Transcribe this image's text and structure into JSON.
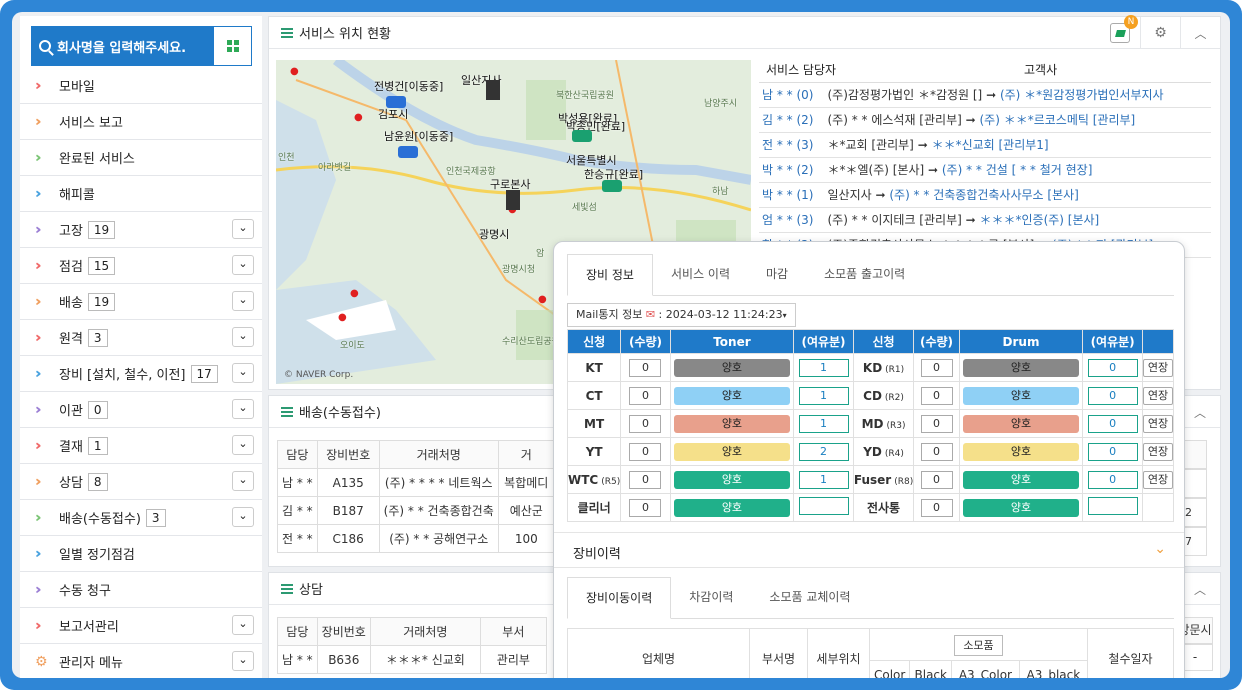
{
  "sidebar": {
    "search_label": "회사명을 입력해주세요.",
    "items": [
      {
        "label": "모바일",
        "color": "#f06a6a"
      },
      {
        "label": "서비스 보고",
        "color": "#f0a060"
      },
      {
        "label": "완료된 서비스",
        "color": "#7cc576"
      },
      {
        "label": "해피콜",
        "color": "#4aa3df"
      },
      {
        "label": "고장",
        "count": "19",
        "color": "#9b7fd4"
      },
      {
        "label": "점검",
        "count": "15",
        "color": "#f06a6a"
      },
      {
        "label": "배송",
        "count": "19",
        "color": "#f0a060"
      },
      {
        "label": "원격",
        "count": "3",
        "color": "#f06a6a"
      },
      {
        "label": "장비 [설치, 철수, 이전]",
        "count": "17",
        "color": "#4aa3df"
      },
      {
        "label": "이관",
        "count": "0",
        "color": "#9b7fd4"
      },
      {
        "label": "결재",
        "count": "1",
        "color": "#f06a6a"
      },
      {
        "label": "상담",
        "count": "8",
        "color": "#f0a060"
      },
      {
        "label": "배송(수동접수)",
        "count": "3",
        "color": "#7cc576"
      },
      {
        "label": "일별 정기점검",
        "color": "#4aa3df"
      },
      {
        "label": "수동 청구",
        "color": "#9b7fd4"
      },
      {
        "label": "보고서관리",
        "color": "#f06a6a"
      },
      {
        "label": "관리자 메뉴",
        "color": "#f0a060"
      }
    ]
  },
  "service": {
    "title": "서비스 위치 현황",
    "badge": "N",
    "col_staff": "서비스 담당자",
    "col_client": "고객사",
    "rows": [
      {
        "staff": "남 * * (0)",
        "from": "(주)감정평가법인 ＊*감정원 []",
        "to": "(주) ＊*원감정평가법인서부지사"
      },
      {
        "staff": "김 * * (2)",
        "from": "(주) * * 에스석재 [관리부]",
        "to": "(주) ＊＊*르코스메틱 [관리부]"
      },
      {
        "staff": "전 * * (3)",
        "from": "＊*교회 [관리부]",
        "to": "＊＊*신교회 [관리부1]"
      },
      {
        "staff": "박 * * (2)",
        "from": "＊*＊엘(주) [본사]",
        "to": "(주) * * 건설 [ * * 철거 현장]"
      },
      {
        "staff": "박 * * (1)",
        "from": "일산지사",
        "to": "(주) * * 건축종합건축사사무소 [본사]"
      },
      {
        "staff": "엄 * * (3)",
        "from": "(주) * * 이지테크 [관리부]",
        "to": "＊＊＊*인증(주) [본사]"
      },
      {
        "staff": "한 * * (2)",
        "from": "(주)종합건축사사무소 ＊＊＊＊루 [본사]",
        "to": "(주) * * 피 [관리부]"
      }
    ],
    "map": {
      "copyright": "© NAVER Corp.",
      "labels": [
        "일산지사",
        "전병건[이동중]",
        "김포시",
        "남윤원[이동중]",
        "박성용[완료]",
        "박종민[완료]",
        "서울특별시",
        "한승규[완료]",
        "구로본사",
        "광명시",
        "남양주시",
        "하남",
        "인천",
        "오이도",
        "북한산국립공원",
        "아라뱃길",
        "인천국제공항",
        "세빛섬",
        "광명시청",
        "수리산도립공원",
        "암"
      ]
    }
  },
  "delivery": {
    "title": "배송(수동접수)",
    "headers": [
      "담당",
      "장비번호",
      "거래처명",
      "거"
    ],
    "rows": [
      [
        "남 * *",
        "A135",
        "(주) * * * * 네트웍스",
        "복합메디"
      ],
      [
        "김 * *",
        "B187",
        "(주) * * 건축종합건축",
        "예산군"
      ],
      [
        "전 * *",
        "C186",
        "(주) * * 공해연구소",
        "100"
      ]
    ],
    "right_times": [
      "42",
      "17"
    ]
  },
  "consult": {
    "title": "상담",
    "headers": [
      "담당",
      "장비번호",
      "거래처명",
      "부서"
    ],
    "rows": [
      [
        "남 * *",
        "B636",
        "＊＊＊* 신교회",
        "관리부"
      ]
    ],
    "right_header": "방문시",
    "right_cell": "-"
  },
  "popup": {
    "tabs": [
      "장비 정보",
      "서비스 이력",
      "마감",
      "소모품 출고이력"
    ],
    "mail_label": "Mail통지 정보",
    "mail_date": ": 2024-03-12 11:24:23",
    "headers": [
      "신청",
      "(수량)",
      "Toner",
      "(여유분)",
      "신청",
      "(수량)",
      "Drum",
      "(여유분)"
    ],
    "rows": [
      {
        "a": "KT",
        "aq": "0",
        "as": "양호",
        "ac": "#888888",
        "ar": "1",
        "b": "KD",
        "bs2": "(R1)",
        "bq": "0",
        "bs": "양호",
        "bc": "#888888",
        "br": "0",
        "ext": "연장"
      },
      {
        "a": "CT",
        "aq": "0",
        "as": "양호",
        "ac": "#8fd0f5",
        "ar": "1",
        "b": "CD",
        "bs2": "(R2)",
        "bq": "0",
        "bs": "양호",
        "bc": "#8fd0f5",
        "br": "0",
        "ext": "연장"
      },
      {
        "a": "MT",
        "aq": "0",
        "as": "양호",
        "ac": "#e8a08c",
        "ar": "1",
        "b": "MD",
        "bs2": "(R3)",
        "bq": "0",
        "bs": "양호",
        "bc": "#e8a08c",
        "br": "0",
        "ext": "연장"
      },
      {
        "a": "YT",
        "aq": "0",
        "as": "양호",
        "ac": "#f5e08a",
        "ar": "2",
        "b": "YD",
        "bs2": "(R4)",
        "bq": "0",
        "bs": "양호",
        "bc": "#f5e08a",
        "br": "0",
        "ext": "연장"
      },
      {
        "a": "WTC",
        "as2": "(R5)",
        "aq": "0",
        "as": "양호",
        "ac": "#20b08a",
        "ar": "1",
        "b": "Fuser",
        "bs2": "(R8)",
        "bq": "0",
        "bs": "양호",
        "bc": "#20b08a",
        "br": "0",
        "ext": "연장"
      },
      {
        "a": "클리너",
        "aq": "0",
        "as": "양호",
        "ac": "#20b08a",
        "ar": "",
        "b": "전사통",
        "bs2": "",
        "bq": "0",
        "bs": "양호",
        "bc": "#20b08a",
        "br": ""
      }
    ],
    "history_title": "장비이력",
    "history_tabs": [
      "장비이동이력",
      "차감이력",
      "소모품 교체이력"
    ],
    "hist_headers": [
      "업체명",
      "부서명",
      "세부위치",
      "소모품",
      "철수일자"
    ],
    "hist_sub": [
      "Color",
      "Black",
      "A3_Color",
      "A3_black"
    ]
  }
}
